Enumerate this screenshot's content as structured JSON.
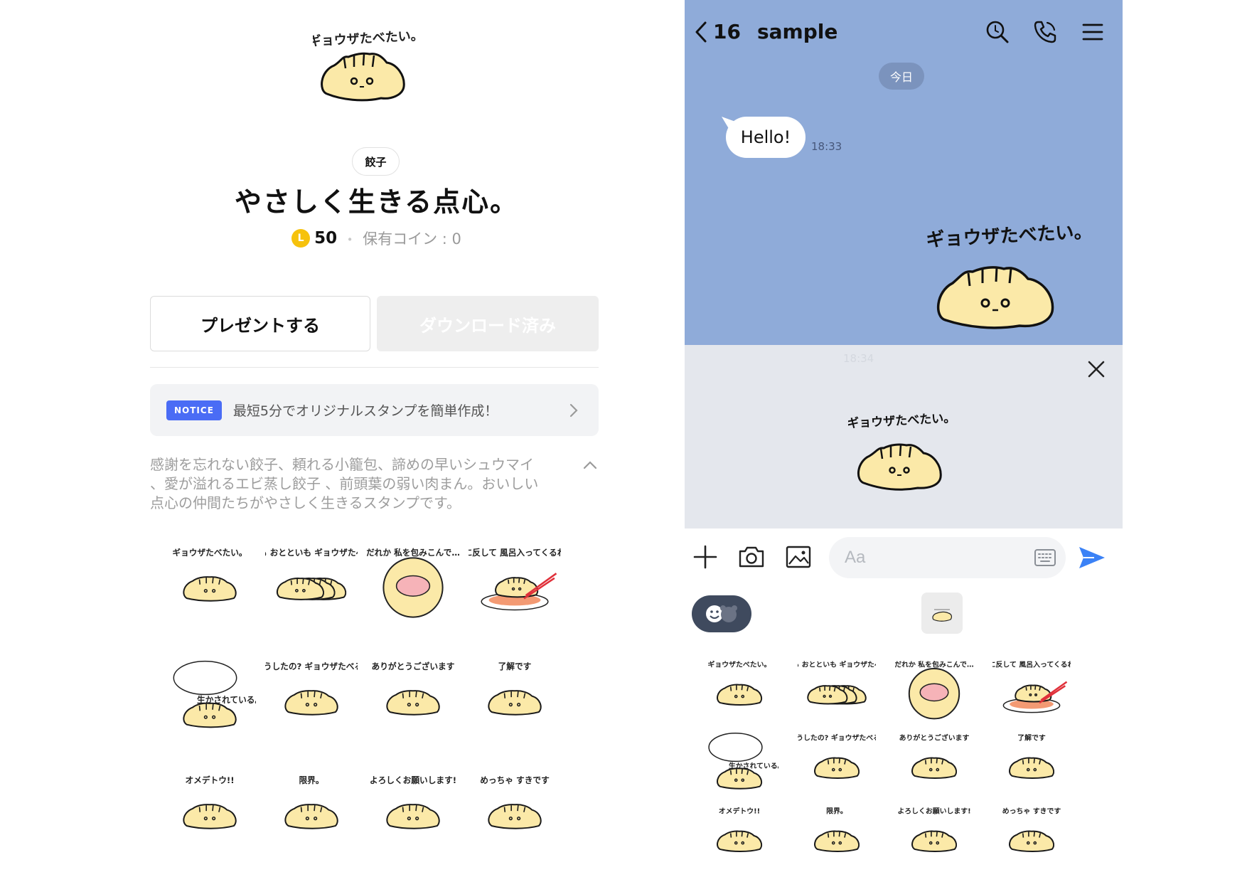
{
  "shop": {
    "hero_caption": "ギョウザたべたい。",
    "tag": "餃子",
    "title": "やさしく生きる点心。",
    "coin_letter": "L",
    "price": "50",
    "separator": "・",
    "owned_coins": "保有コイン : 0",
    "gift_button": "プレゼントする",
    "download_button": "ダウンロード済み",
    "notice_badge": "NOTICE",
    "notice_text": "最短5分でオリジナルスタンプを簡単作成！",
    "description_lines": [
      "感謝を忘れない餃子、頼れる小籠包、諦めの早いシュウマイ",
      "、愛が溢れるエビ蒸し餃子 、前頭葉の弱い肉まん。おいしい",
      "点心の仲間たちがやさしく生きるスタンプです。"
    ],
    "stickers": [
      {
        "caption": "ギョウザたべたい。",
        "kind": "gyoza"
      },
      {
        "caption": "きのうも おとといも ギョウザたべたな。",
        "kind": "gyoza-row"
      },
      {
        "caption": "だれか 私を包みこんで…",
        "kind": "wrapper"
      },
      {
        "caption": "愛に反して 風呂入ってくるわ。",
        "kind": "plate"
      },
      {
        "caption": "生かされている。",
        "kind": "thought"
      },
      {
        "caption": "どうしたの? ギョウザたべる?",
        "kind": "gyoza"
      },
      {
        "caption": "ありがとうございます",
        "kind": "gyoza"
      },
      {
        "caption": "了解です",
        "kind": "gyoza"
      },
      {
        "caption": "オメデトウ!!",
        "kind": "gyoza"
      },
      {
        "caption": "限界。",
        "kind": "gyoza"
      },
      {
        "caption": "よろしくお願いします!",
        "kind": "gyoza"
      },
      {
        "caption": "めっちゃ すきです",
        "kind": "gyoza"
      }
    ]
  },
  "chat": {
    "unread_count": "16",
    "title": "sample",
    "date_label": "今日",
    "message_text": "Hello!",
    "message_time": "18:33",
    "sticker_caption": "ギョウザたべたい。",
    "preview_time": "18:34",
    "input_placeholder": "Aa"
  },
  "colors": {
    "chat_background": "#8fabd9",
    "notice_badge": "#4a6cf5",
    "coin": "#f6c20d",
    "send_arrow": "#3b82f6",
    "gyoza_fill": "#fbe9a8"
  }
}
